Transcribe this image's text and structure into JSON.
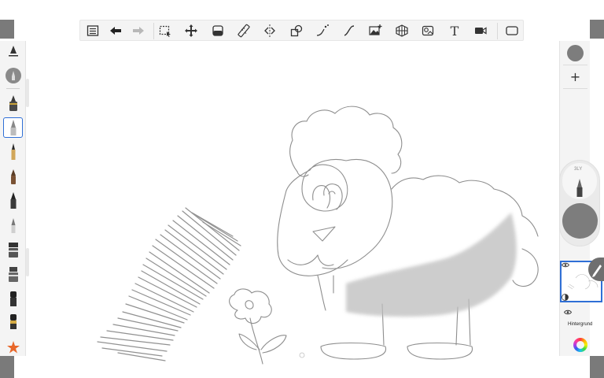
{
  "toolbar": {
    "icons": [
      "list-icon",
      "undo-icon",
      "redo-icon",
      "selection-icon",
      "transform-icon",
      "fill-icon",
      "ruler-icon",
      "symmetry-icon",
      "shapes-icon",
      "guide-curve-icon",
      "brush-stroke-icon",
      "image-import-icon",
      "perspective-icon",
      "ghost-icon",
      "text-icon",
      "video-icon",
      "fullscreen-icon"
    ],
    "text_tool_glyph": "T"
  },
  "brushes": {
    "selected_index": 1,
    "favorites_icon": "star-icon"
  },
  "layers": {
    "add_symbol": "+",
    "opacity_value": "3LY",
    "background_layer_label": "Hintergrund",
    "color_swatch": "#7d7d7d"
  },
  "colors": {
    "accent": "#2f6fd6",
    "canvas": "#ffffff",
    "panel": "#f4f4f4",
    "corner": "#7a7a7a",
    "star": "#e8672a"
  }
}
